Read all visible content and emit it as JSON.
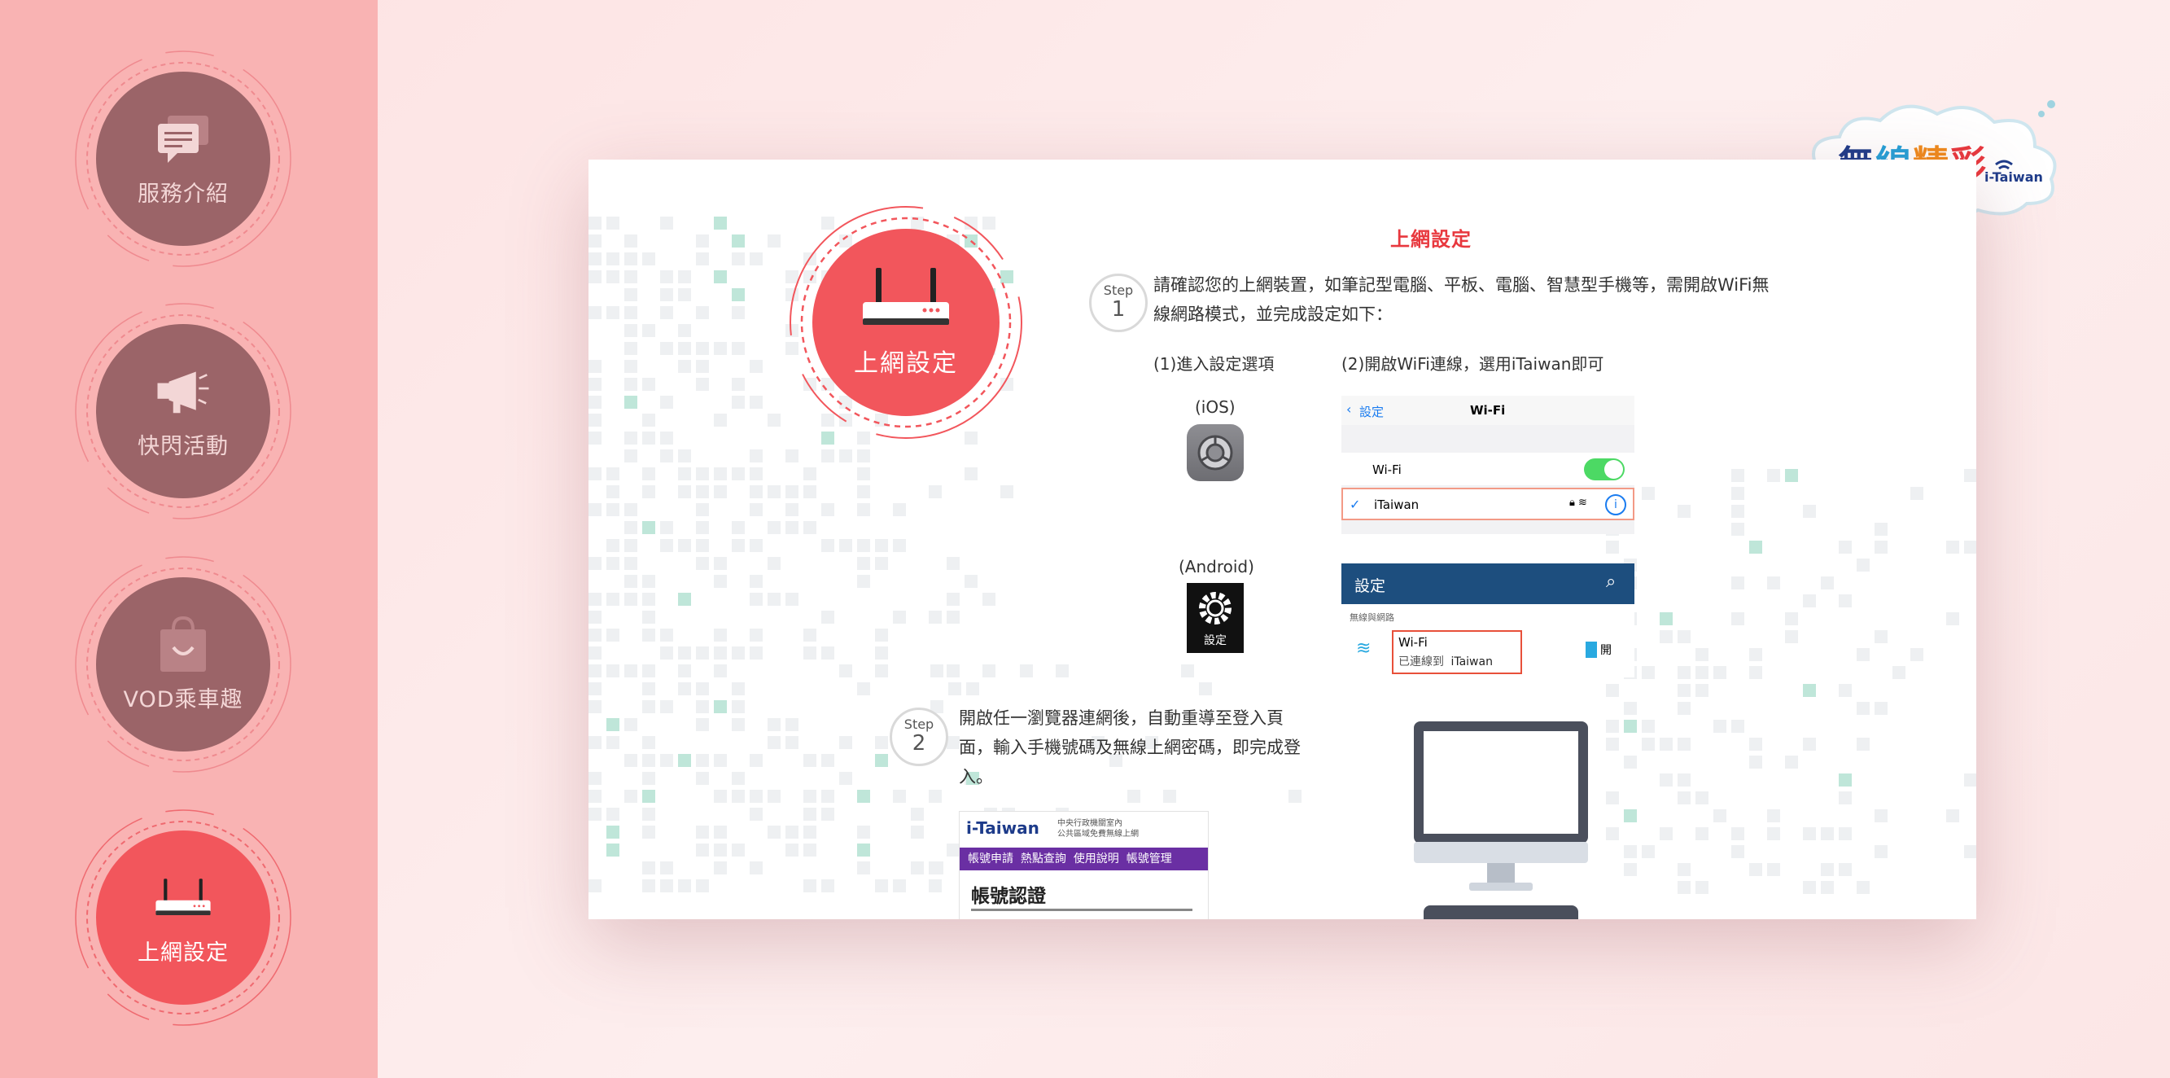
{
  "sidebar": {
    "items": [
      {
        "label": "服務介紹",
        "icon": "chat-bubble-icon",
        "active": false
      },
      {
        "label": "快閃活動",
        "icon": "megaphone-icon",
        "active": false
      },
      {
        "label": "VOD乘車趣",
        "icon": "shopping-bag-icon",
        "active": false
      },
      {
        "label": "上網設定",
        "icon": "router-icon",
        "active": true
      }
    ]
  },
  "logo": {
    "text": "無線精彩",
    "sub": "i-Taiwan"
  },
  "page": {
    "hero_label": "上網設定",
    "title": "上網設定",
    "step1": {
      "badge_word": "Step",
      "badge_num": "1",
      "text": "請確認您的上網裝置，如筆記型電腦、平板、電腦、智慧型手機等，需開啟WiFi無線網路模式，並完成設定如下：",
      "sub1": "(1)進入設定選項",
      "sub2": "(2)開啟WiFi連線，選用iTaiwan即可",
      "ios_label": "(iOS)",
      "android_label": "(Android)",
      "android_icon_label": "設定",
      "ios_panel": {
        "back": "設定",
        "title": "Wi-Fi",
        "wifi_row": "Wi-Fi",
        "network": "iTaiwan"
      },
      "android_panel": {
        "title": "設定",
        "section": "無線與網路",
        "wifi": "Wi-Fi",
        "status_prefix": "已連線到",
        "network": "iTaiwan",
        "toggle": "開"
      }
    },
    "step2": {
      "badge_word": "Step",
      "badge_num": "2",
      "text": "開啟任一瀏覽器連網後，自動重導至登入頁面，輸入手機號碼及無線上網密碼，即完成登入。",
      "portal": {
        "brand": "i-Taiwan",
        "org_line1": "中央行政機關室內",
        "org_line2": "公共區域免費無線上網",
        "menu": [
          "帳號申請",
          "熱點查詢",
          "使用說明",
          "帳號管理"
        ],
        "heading": "帳號認證"
      }
    }
  },
  "colors": {
    "sidebar": "#f9b3b3",
    "disc": "#9b6468",
    "accent": "#f2565c",
    "title": "#e8383e"
  }
}
